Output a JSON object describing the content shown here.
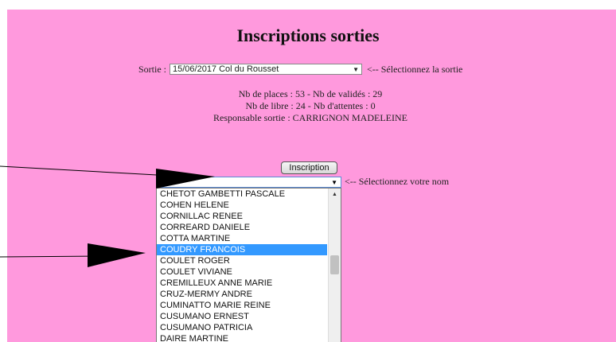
{
  "header": {
    "title": "Inscriptions sorties"
  },
  "sortie": {
    "label": "Sortie :",
    "selected": "15/06/2017 Col du Rousset",
    "hint": "<-- Sélectionnez la sortie"
  },
  "info": {
    "line1": "Nb de places : 53 - Nb de validés : 29",
    "line2": "Nb de libre : 24 - Nb d'attentes : 0",
    "line3": "Responsable sortie : CARRIGNON MADELEINE"
  },
  "inscription_button": "Inscription",
  "name_select": {
    "value": "",
    "hint": "<-- Sélectionnez votre nom"
  },
  "names": [
    "CHETOT GAMBETTI PASCALE",
    "COHEN HELENE",
    "CORNILLAC RENEE",
    "CORREARD DANIELE",
    "COTTA MARTINE",
    "COUDRY FRANCOIS",
    "COULET ROGER",
    "COULET VIVIANE",
    "CREMILLEUX ANNE MARIE",
    "CRUZ-MERMY ANDRE",
    "CUMINATTO MARIE REINE",
    "CUSUMANO ERNEST",
    "CUSUMANO PATRICIA",
    "DAIRE MARTINE"
  ],
  "selected_name": "COUDRY FRANCOIS",
  "colors": {
    "background": "#ff99dd",
    "highlight": "#3399ff"
  }
}
